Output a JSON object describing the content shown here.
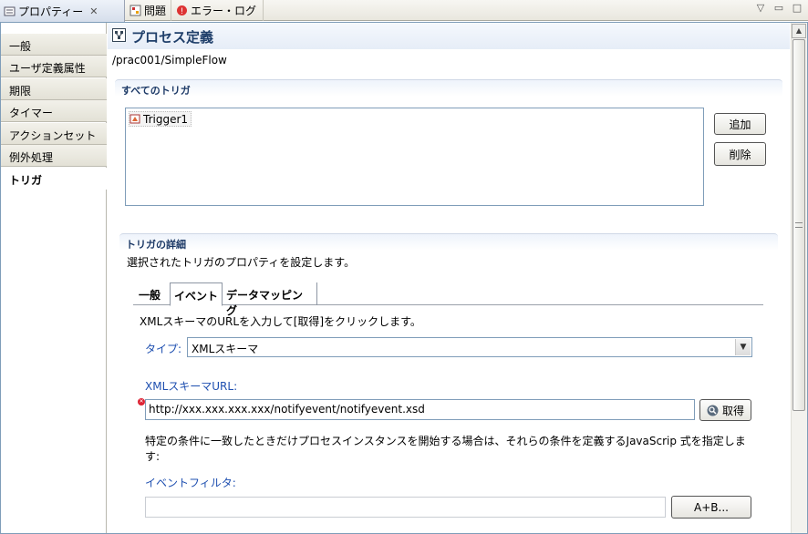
{
  "tabs": [
    {
      "label": "プロパティー",
      "icon": "properties-icon",
      "active": true
    },
    {
      "label": "問題",
      "icon": "problems-icon"
    },
    {
      "label": "エラー・ログ",
      "icon": "error-log-icon"
    }
  ],
  "nav": [
    "一般",
    "ユーザ定義属性",
    "期限",
    "タイマー",
    "アクションセット",
    "例外処理",
    "トリガ"
  ],
  "nav_selected": "トリガ",
  "header": {
    "title": "プロセス定義",
    "path": "/prac001/SimpleFlow"
  },
  "all_triggers": {
    "section_title": "すべてのトリガ",
    "items": [
      "Trigger1"
    ],
    "add_label": "追加",
    "delete_label": "削除"
  },
  "details": {
    "section_title": "トリガの詳細",
    "description": "選択されたトリガのプロパティを設定します。",
    "tabs": [
      "一般",
      "イベント",
      "データマッピング"
    ],
    "active_tab": "イベント",
    "event": {
      "instruction": "XMLスキーマのURLを入力して[取得]をクリックします。",
      "type_label": "タイプ:",
      "type_value": "XMLスキーマ",
      "url_label": "XMLスキーマURL:",
      "url_value": "http://xxx.xxx.xxx.xxx/notifyevent/notifyevent.xsd",
      "get_label": "取得",
      "condition_text": "特定の条件に一致したときだけプロセスインスタンスを開始する場合は、それらの条件を定義するJavaScrip 式を指定します:",
      "filter_label": "イベントフィルタ:",
      "filter_value": "",
      "expression_button": "A+B..."
    }
  },
  "colors": {
    "accent": "#1e4fb0",
    "title": "#1f3f6a",
    "error": "#dd2233"
  }
}
